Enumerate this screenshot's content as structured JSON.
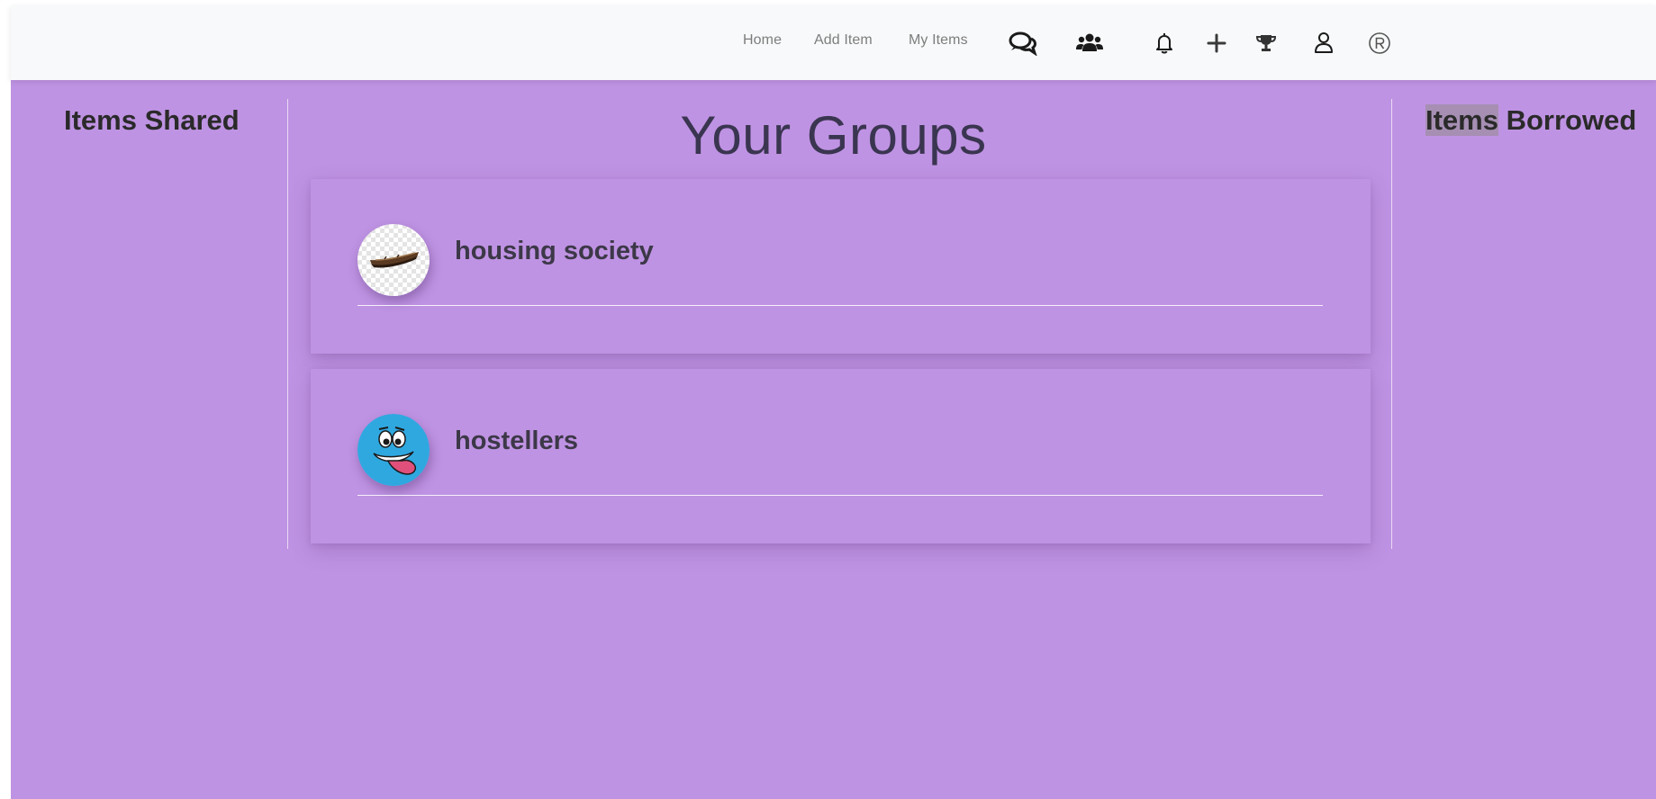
{
  "nav": {
    "links": [
      "Home",
      "Add Item",
      "My Items"
    ],
    "icons": [
      "chat-icon",
      "users-icon",
      "bell-icon",
      "plus-icon",
      "trophy-icon",
      "user-icon",
      "registered-icon"
    ]
  },
  "left_panel": {
    "title": "Items Shared"
  },
  "main": {
    "title": "Your Groups",
    "groups": [
      {
        "name": "housing society",
        "avatar": "boat-image"
      },
      {
        "name": "hostellers",
        "avatar": "smiley-face-image"
      }
    ]
  },
  "right_panel": {
    "title_highlighted": "Items",
    "title_rest": " Borrowed"
  },
  "colors": {
    "background": "#bf93e3",
    "navbar": "#f8f9fa",
    "nav_text": "#7d7d7d",
    "heading_text": "#2a2a2a"
  }
}
